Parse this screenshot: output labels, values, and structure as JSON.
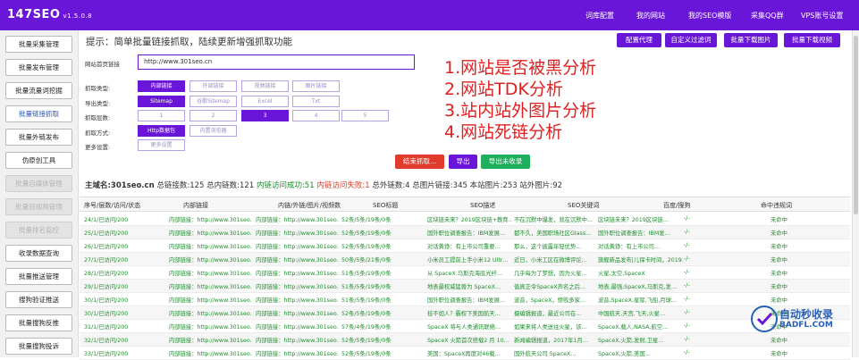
{
  "header": {
    "title": "147SEO",
    "version": "v1.5.0.8",
    "nav": [
      "词库配置",
      "我的网站",
      "我的SEO模版",
      "采集QQ群",
      "VPS账号设置"
    ]
  },
  "sidebar": {
    "items": [
      {
        "label": "批量采集管理",
        "state": "normal"
      },
      {
        "label": "批量发布管理",
        "state": "normal"
      },
      {
        "label": "批量流量词挖掘",
        "state": "normal"
      },
      {
        "label": "批量链接抓取",
        "state": "active"
      },
      {
        "label": "批量外链发布",
        "state": "normal"
      },
      {
        "label": "伪原创工具",
        "state": "normal"
      },
      {
        "label": "批量自媒体管理",
        "state": "disabled"
      },
      {
        "label": "批量短视频管理",
        "state": "disabled"
      },
      {
        "label": "批量排名监控",
        "state": "disabled"
      },
      {
        "label": "收录数据查询",
        "state": "normal"
      },
      {
        "label": "批量推送管理",
        "state": "normal"
      },
      {
        "label": "搜狗验证推送",
        "state": "normal"
      },
      {
        "label": "批量搜狗反推",
        "state": "normal"
      },
      {
        "label": "批量搜狗投诉",
        "state": "normal"
      }
    ]
  },
  "main": {
    "tip": "提示：简单批量链接抓取，陆续更新增强抓取功能",
    "top_buttons": [
      "配置代理",
      "自定义过滤词",
      "批量下载图片",
      "批量下载视频"
    ],
    "form": {
      "url_label": "网站首页链接",
      "url_value": "http://www.301seo.cn",
      "crawl_type_label": "抓取类型:",
      "crawl_types": [
        "内部链接",
        "外部链接",
        "视频链接",
        "图片链接"
      ],
      "export_type_label": "导出类型:",
      "export_types": [
        "Sitemap",
        "谷歌Sitemap",
        "Excel",
        "Txt"
      ],
      "depth_label": "抓取层数:",
      "depths": [
        "1",
        "2",
        "3",
        "4",
        "5"
      ],
      "method_label": "抓取方式:",
      "methods": [
        "Http数据包",
        "内置浏览器"
      ],
      "more_label": "更多设置:",
      "more_button": "更多设置"
    },
    "overlay_lines": [
      "1.网站是否被黑分析",
      "2.网站TDK分析",
      "3.站内站外图片分析",
      "4.网站死链分析"
    ],
    "action_buttons": [
      "结束抓取...",
      "导出",
      "导出未收录"
    ],
    "stats": {
      "domain": "主域名:301seo.cn",
      "total": "总链接数:125",
      "internal": "总内链数:121",
      "ok": "内链访问成功:51",
      "fail": "内链访问失败:1",
      "external": "总外链数:4",
      "images": "总图片链接:345",
      "local_images": "本站图片:253",
      "outside_images": "站外图片:92"
    },
    "table": {
      "headers": [
        "序号/层数/访问/状态",
        "内部链接",
        "内链/外链/图片/视频数",
        "SEO标题",
        "SEO描述",
        "SEO关键词",
        "百度/搜狗",
        "命中违规词"
      ],
      "rows": [
        [
          "24/1/已访问/200",
          "内部链接：http://www.301seo.cn/",
          "内部链接：http://www.301seo.cn/",
          "52条/5条/19条/0条",
          "区块链未来？2019区块链+教育…",
          "不在沉默中爆发，就在沉默中…",
          "区块链未来？2019区块链…",
          "-/-",
          "未命中"
        ],
        [
          "25/1/已访问/200",
          "内部链接：http://www.301seo.cn/",
          "内部链接：http://www.301seo.cn/",
          "52条/5条/19条/0条",
          "国外职位调查报告：IBM发展…",
          "都不久，美国职场社区Glass…",
          "国外职位调查报告：IBM发…",
          "-/-",
          "未命中"
        ],
        [
          "26/1/已访问/200",
          "内部链接：http://www.301seo.cn/",
          "内部链接：http://www.301seo.cn/",
          "52条/5条/19条/0条",
          "对话黄铮：有上市公司重要…",
          "那么，这个披露年轻优势…",
          "对话黄铮：有上市公司…",
          "-/-",
          "未命中"
        ],
        [
          "27/1/已访问/200",
          "内部链接：http://www.301seo.cn/",
          "内部链接：http://www.301seo.cn/",
          "50条/5条/21条/0条",
          "小米员工提前上手小米12 Ultr…",
          "近日，小米工区在微博评论…",
          "旗舰新品发布|儿保卡时间，2019…",
          "-/-",
          "未命中"
        ],
        [
          "28/1/已访问/200",
          "内部链接：http://www.301seo.cn/",
          "内部链接：http://www.301seo.cn/",
          "51条/5条/19条/0条",
          "从 SpaceX 马斯克海底光纤…",
          "几乎每为了梦想，因为火星…",
          "火星,太空,SpaceX",
          "-/-",
          "未命中"
        ],
        [
          "29/1/已访问/200",
          "内部链接：http://www.301seo.cn/",
          "内部链接：http://www.301seo.cn/",
          "51条/5条/19条/0条",
          "地表最权威猛兽为 SpaceX…",
          "值真正令SpaceX声名之后…",
          "地表,最强,SpaceX,马斯克,发…",
          "-/-",
          "未命中"
        ],
        [
          "30/1/已访问/200",
          "内部链接：http://www.301seo.cn/",
          "内部链接：http://www.301seo.cn/",
          "51条/5条/19条/0条",
          "国外职位调查报告：IBM发展…",
          "波音，SpaceX，惨败多家…",
          "波音,SpaceX,星际,飞船,月球…",
          "-/-",
          "未命中"
        ],
        [
          "30/1/已访问/200",
          "内部链接：http://www.301seo.cn/",
          "内部链接：http://www.301seo.cn/",
          "52条/5条/19条/0条",
          "技不如人？霸权下美国航天…",
          "摄编辑报道，最近公司在…",
          "中国航天,天宫,飞天,火星…",
          "-/-",
          "未命中"
        ],
        [
          "31/1/已访问/200",
          "内部链接：http://www.301seo.cn/",
          "内部链接：http://www.301seo.cn/",
          "57条/4条/19条/0条",
          "SpaceX 将与人类通讯联络…",
          "如果来将人类送往火星，该…",
          "SpaceX,载人,NASA,航空…",
          "-/-",
          "未命中"
        ],
        [
          "32/1/已访问/200",
          "内部链接：http://www.301seo.cn/",
          "内部链接：http://www.301seo.cn/",
          "52条/5条/19条/0条",
          "SpaceX 火箭首次搭载2 月 10…",
          "新闻编辑报道，2017年1月…",
          "SpaceX,火箭,发射,卫星…",
          "-/-",
          "未命中"
        ],
        [
          "33/1/已访问/200",
          "内部链接：http://www.301seo.cn/",
          "内部链接：http://www.301seo.cn/",
          "52条/5条/19条/0条",
          "美国：SpaceX再度对46载…",
          "国外航天公司 SpaceX…",
          "SpaceX,火箭,美国…",
          "-/-",
          "未命中"
        ]
      ]
    }
  },
  "watermark": {
    "line1": "自动秒收录",
    "line2": "BADFL.COM"
  }
}
